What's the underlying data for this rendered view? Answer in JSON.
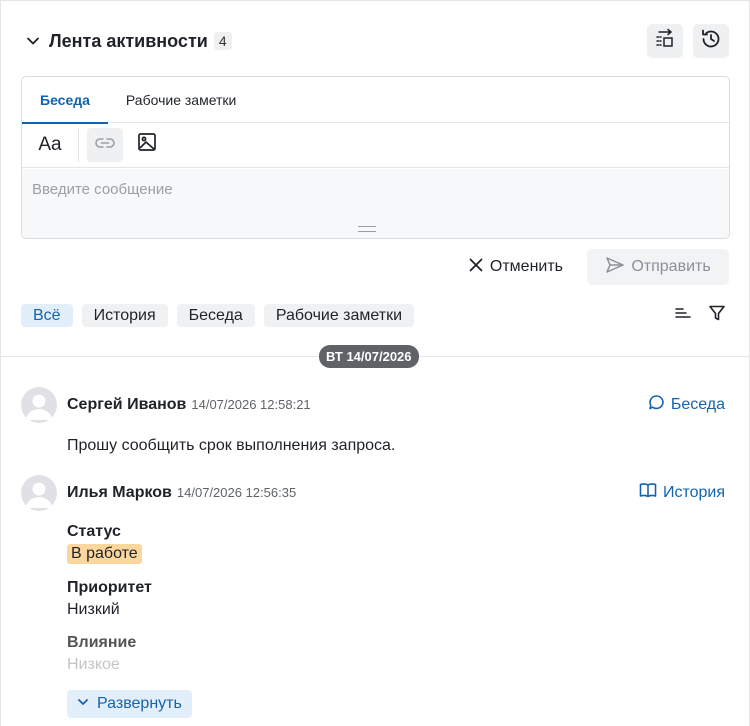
{
  "header": {
    "title": "Лента активности",
    "count": "4"
  },
  "composer": {
    "tabs": [
      {
        "label": "Беседа",
        "active": true
      },
      {
        "label": "Рабочие заметки",
        "active": false
      }
    ],
    "toolbar": {
      "format_label": "Aa"
    },
    "placeholder": "Введите сообщение"
  },
  "actions": {
    "cancel_label": "Отменить",
    "send_label": "Отправить"
  },
  "filters": [
    {
      "label": "Всё",
      "active": true
    },
    {
      "label": "История",
      "active": false
    },
    {
      "label": "Беседа",
      "active": false
    },
    {
      "label": "Рабочие заметки",
      "active": false
    }
  ],
  "date_separator": "ВТ 14/07/2026",
  "entries": [
    {
      "author": "Сергей Иванов",
      "time": "14/07/2026 12:58:21",
      "kind": "Беседа",
      "message": "Прошу сообщить срок выполнения запроса."
    },
    {
      "author": "Илья Марков",
      "time": "14/07/2026 12:56:35",
      "kind": "История",
      "fields": [
        {
          "label": "Статус",
          "value": "В работе"
        },
        {
          "label": "Приоритет",
          "value": "Низкий"
        },
        {
          "label": "Влияние",
          "value": "Низкое"
        }
      ]
    }
  ],
  "expand_label": "Развернуть",
  "colors": {
    "accent": "#1264b0",
    "status_badge": "#fbd79e",
    "date_pill": "#5f6368"
  }
}
